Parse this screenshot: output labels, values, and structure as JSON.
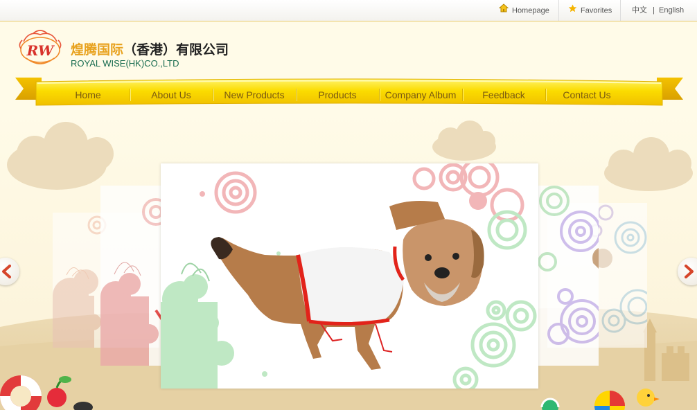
{
  "topbar": {
    "homepage": "Homepage",
    "favorites": "Favorites",
    "lang_zh": "中文",
    "lang_sep": "|",
    "lang_en": "English"
  },
  "header": {
    "logo_text": "RW",
    "company_cn_gold": "煌腾国际",
    "company_cn_rest": "（香港）有限公司",
    "company_en": "ROYAL WISE(HK)CO.,LTD"
  },
  "nav": {
    "items": [
      {
        "label": "Home"
      },
      {
        "label": "About Us"
      },
      {
        "label": "New Products"
      },
      {
        "label": "Products"
      },
      {
        "label": "Company Album"
      },
      {
        "label": "Feedback"
      },
      {
        "label": "Contact Us"
      }
    ]
  },
  "slider": {
    "slides": [
      {
        "subject": "slide-far-left"
      },
      {
        "subject": "slide-near-left"
      },
      {
        "subject": "dog-in-shirt"
      },
      {
        "subject": "slide-near-right"
      },
      {
        "subject": "slide-far-right"
      }
    ],
    "prev_icon": "chevron-left-icon",
    "next_icon": "chevron-right-icon"
  },
  "colors": {
    "accent_gold": "#f7d200",
    "nav_text": "#7a5a10",
    "company_green": "#156a4e",
    "company_gold": "#e8a21e",
    "arrow_red": "#d6452a"
  }
}
